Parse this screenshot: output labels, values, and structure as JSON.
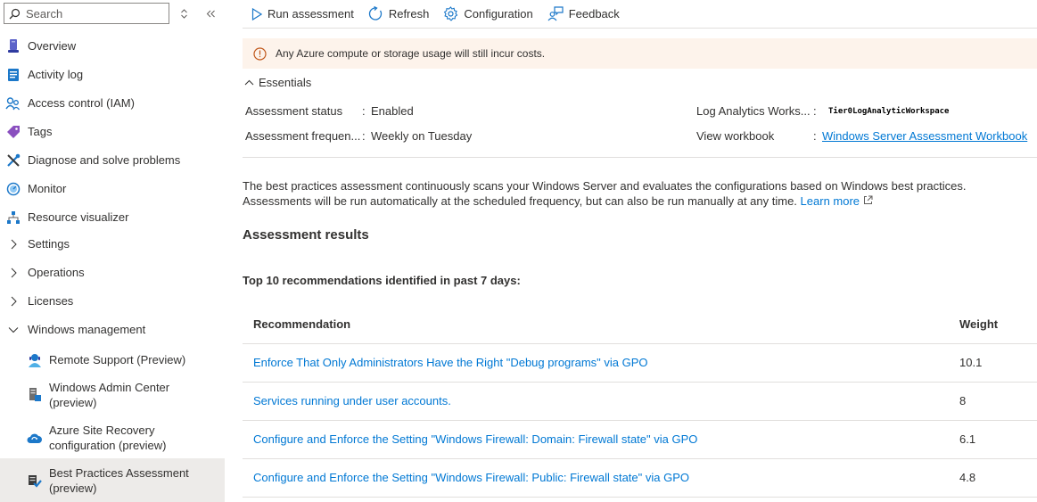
{
  "sidebar": {
    "search_placeholder": "Search",
    "items": [
      {
        "label": "Overview",
        "icon": "overview-icon"
      },
      {
        "label": "Activity log",
        "icon": "activity-log-icon"
      },
      {
        "label": "Access control (IAM)",
        "icon": "iam-icon"
      },
      {
        "label": "Tags",
        "icon": "tag-icon"
      },
      {
        "label": "Diagnose and solve problems",
        "icon": "wrench-icon"
      },
      {
        "label": "Monitor",
        "icon": "monitor-icon"
      },
      {
        "label": "Resource visualizer",
        "icon": "visualizer-icon"
      },
      {
        "label": "Settings",
        "icon": "chevron-right-icon"
      },
      {
        "label": "Operations",
        "icon": "chevron-right-icon"
      },
      {
        "label": "Licenses",
        "icon": "chevron-right-icon"
      },
      {
        "label": "Windows management",
        "icon": "chevron-down-icon"
      },
      {
        "label": "Remote Support (Preview)",
        "icon": "remote-support-icon"
      },
      {
        "label": "Windows Admin Center (preview)",
        "icon": "admin-center-icon"
      },
      {
        "label": "Azure Site Recovery configuration (preview)",
        "icon": "site-recovery-icon"
      },
      {
        "label": "Best Practices Assessment (preview)",
        "icon": "best-practices-icon"
      }
    ]
  },
  "toolbar": {
    "run_label": "Run assessment",
    "refresh_label": "Refresh",
    "config_label": "Configuration",
    "feedback_label": "Feedback"
  },
  "banner": {
    "text": "Any Azure compute or storage usage will still incur costs."
  },
  "essentials": {
    "toggle_label": "Essentials",
    "status_label": "Assessment status",
    "status_value": "Enabled",
    "frequency_label": "Assessment frequen...",
    "frequency_value": "Weekly on Tuesday",
    "workspace_label": "Log Analytics Works...",
    "workspace_value": "Tier0LogAnalyticWorkspace",
    "workbook_label": "View workbook",
    "workbook_value": "Windows Server Assessment Workbook",
    "colon": ":"
  },
  "description": {
    "line1": "The best practices assessment continuously scans your Windows Server and evaluates the configurations based on Windows best practices.",
    "line2": "Assessments will be run automatically at the scheduled frequency, but can also be run manually at any time.",
    "learn_more": "Learn more"
  },
  "results": {
    "heading": "Assessment results",
    "subheading": "Top 10 recommendations identified in past 7 days:",
    "columns": {
      "recommendation": "Recommendation",
      "weight": "Weight"
    },
    "rows": [
      {
        "recommendation": "Enforce That Only Administrators Have the Right \"Debug programs\" via GPO",
        "weight": "10.1"
      },
      {
        "recommendation": "Services running under user accounts.",
        "weight": "8"
      },
      {
        "recommendation": "Configure and Enforce the Setting \"Windows Firewall: Domain: Firewall state\" via GPO",
        "weight": "6.1"
      },
      {
        "recommendation": "Configure and Enforce the Setting \"Windows Firewall: Public: Firewall state\" via GPO",
        "weight": "4.8"
      }
    ]
  },
  "colors": {
    "link": "#0078d4",
    "banner": "#fdf3eb",
    "selected": "#edebe9"
  }
}
